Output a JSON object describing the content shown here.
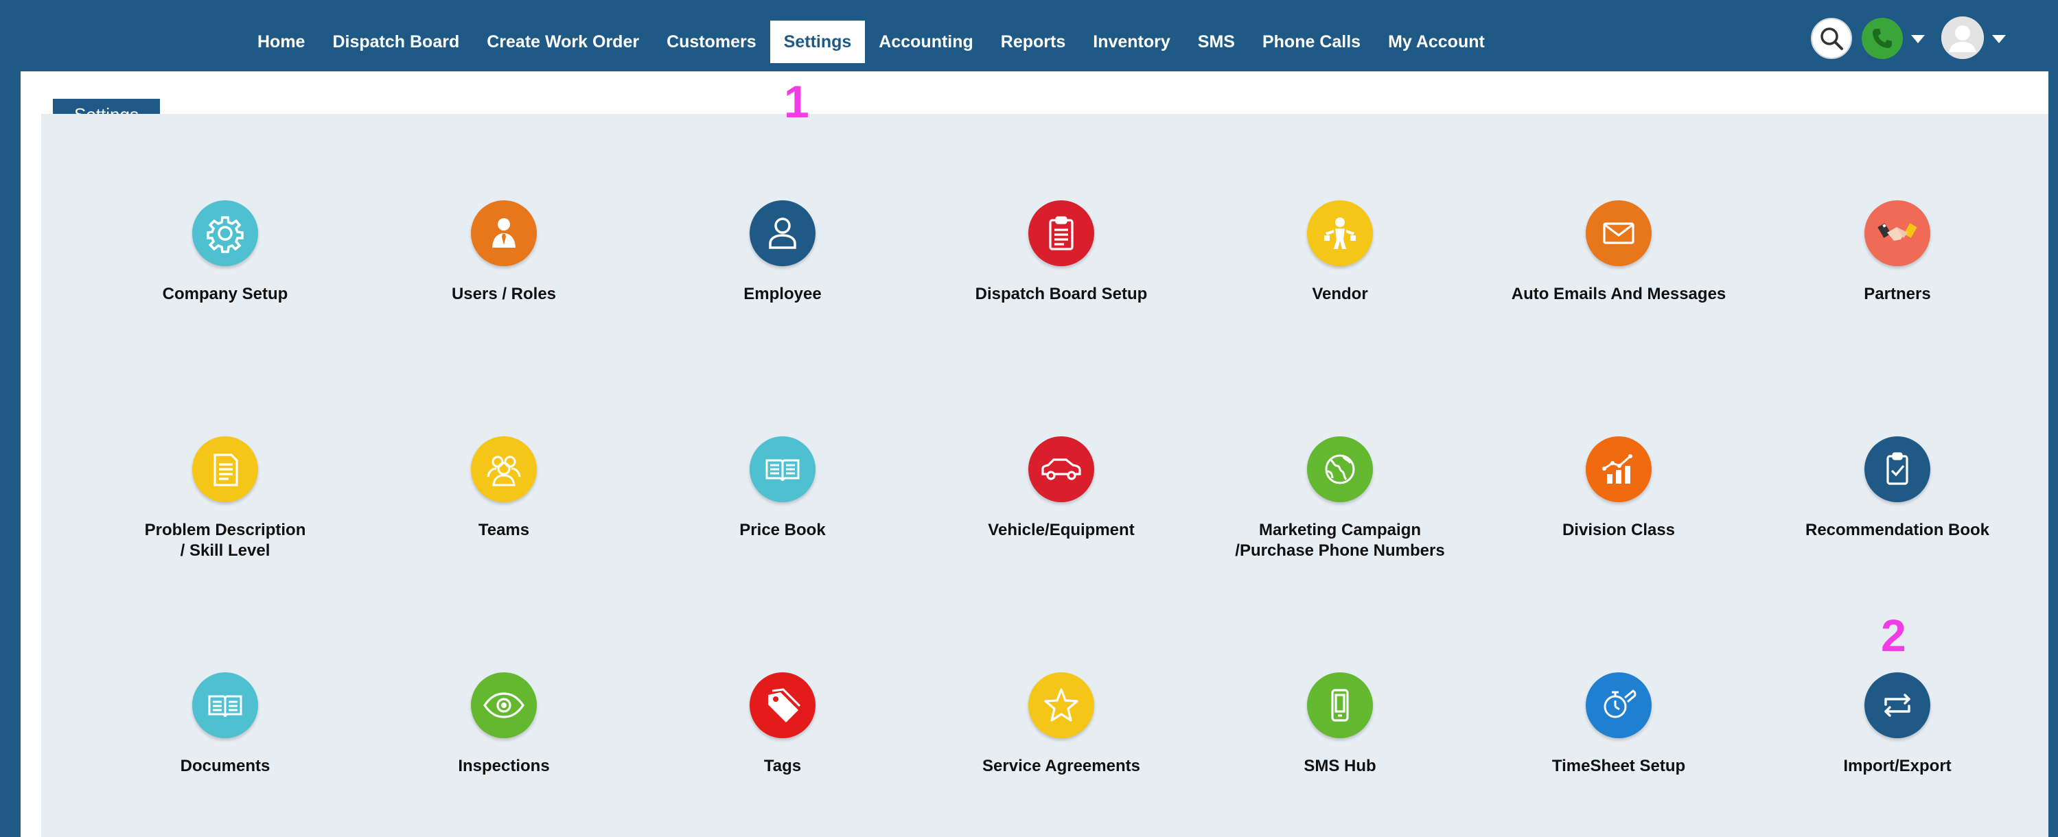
{
  "nav": {
    "items": [
      "Home",
      "Dispatch Board",
      "Create Work Order",
      "Customers",
      "Settings",
      "Accounting",
      "Reports",
      "Inventory",
      "SMS",
      "Phone Calls",
      "My Account"
    ],
    "active": "Settings"
  },
  "icons": {
    "search": "search-icon",
    "phone": "phone-icon",
    "avatar": "user-avatar-icon"
  },
  "panel": {
    "tab_label": "Settings"
  },
  "markers": [
    "1",
    "2"
  ],
  "tiles": [
    {
      "label": "Company Setup",
      "icon": "gear-icon",
      "color": "#4fc0d0"
    },
    {
      "label": "Users / Roles",
      "icon": "user-tie-icon",
      "color": "#e8761a"
    },
    {
      "label": "Employee",
      "icon": "person-icon",
      "color": "#1f5a86"
    },
    {
      "label": "Dispatch Board Setup",
      "icon": "clipboard-icon",
      "color": "#d81f2b"
    },
    {
      "label": "Vendor",
      "icon": "vendor-icon",
      "color": "#f5c617"
    },
    {
      "label": "Auto Emails And Messages",
      "icon": "envelope-icon",
      "color": "#e8761a"
    },
    {
      "label": "Partners",
      "icon": "handshake-icon",
      "color": "#f06a55"
    },
    {
      "label": "Problem Description\n/ Skill Level",
      "icon": "document-icon",
      "color": "#f5c617"
    },
    {
      "label": "Teams",
      "icon": "team-icon",
      "color": "#f5c617"
    },
    {
      "label": "Price Book",
      "icon": "open-book-icon",
      "color": "#4fc0d0"
    },
    {
      "label": "Vehicle/Equipment",
      "icon": "car-icon",
      "color": "#d81f2b"
    },
    {
      "label": "Marketing Campaign\n/Purchase Phone Numbers",
      "icon": "globe-icon",
      "color": "#63b830"
    },
    {
      "label": "Division Class",
      "icon": "bar-chart-icon",
      "color": "#f26a10"
    },
    {
      "label": "Recommendation Book",
      "icon": "checklist-icon",
      "color": "#1f5a86"
    },
    {
      "label": "Documents",
      "icon": "book-icon",
      "color": "#4fc0d0"
    },
    {
      "label": "Inspections",
      "icon": "eye-icon",
      "color": "#63b830"
    },
    {
      "label": "Tags",
      "icon": "tag-icon",
      "color": "#e31b1b"
    },
    {
      "label": "Service Agreements",
      "icon": "star-icon",
      "color": "#f5c617"
    },
    {
      "label": "SMS Hub",
      "icon": "mobile-icon",
      "color": "#63b830"
    },
    {
      "label": "TimeSheet Setup",
      "icon": "stopwatch-wrench-icon",
      "color": "#1f7fd0"
    },
    {
      "label": "Import/Export",
      "icon": "swap-arrows-icon",
      "color": "#1f5a86"
    }
  ]
}
